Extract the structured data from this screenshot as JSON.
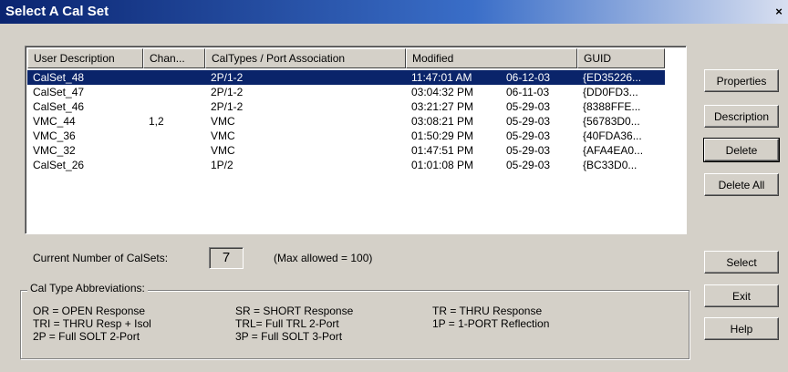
{
  "window": {
    "title": "Select A Cal Set",
    "close_glyph": "×"
  },
  "list": {
    "columns": [
      "User Description",
      "Chan...",
      "CalTypes / Port Association",
      "Modified",
      "GUID"
    ],
    "rows": [
      {
        "desc": "CalSet_48",
        "chan": "",
        "caltype": "2P/1-2",
        "time": "11:47:01 AM",
        "date": "06-12-03",
        "guid": "{ED35226...",
        "selected": true
      },
      {
        "desc": "CalSet_47",
        "chan": "",
        "caltype": "2P/1-2",
        "time": "03:04:32 PM",
        "date": "06-11-03",
        "guid": "{DD0FD3...",
        "selected": false
      },
      {
        "desc": "CalSet_46",
        "chan": "",
        "caltype": "2P/1-2",
        "time": "03:21:27 PM",
        "date": "05-29-03",
        "guid": "{8388FFE...",
        "selected": false
      },
      {
        "desc": "VMC_44",
        "chan": "1,2",
        "caltype": "VMC",
        "time": "03:08:21 PM",
        "date": "05-29-03",
        "guid": "{56783D0...",
        "selected": false
      },
      {
        "desc": "VMC_36",
        "chan": "",
        "caltype": "VMC",
        "time": "01:50:29 PM",
        "date": "05-29-03",
        "guid": "{40FDA36...",
        "selected": false
      },
      {
        "desc": "VMC_32",
        "chan": "",
        "caltype": "VMC",
        "time": "01:47:51 PM",
        "date": "05-29-03",
        "guid": "{AFA4EA0...",
        "selected": false
      },
      {
        "desc": "CalSet_26",
        "chan": "",
        "caltype": "1P/2",
        "time": "01:01:08 PM",
        "date": "05-29-03",
        "guid": "{BC33D0...",
        "selected": false
      }
    ]
  },
  "buttons": {
    "properties": "Properties",
    "description": "Description",
    "delete": "Delete",
    "delete_all": "Delete All",
    "select": "Select",
    "exit": "Exit",
    "help": "Help"
  },
  "count": {
    "label": "Current Number of CalSets:",
    "value": "7",
    "max": "(Max allowed = 100)"
  },
  "abbreviations": {
    "title": "Cal Type Abbreviations:",
    "items": [
      "OR  = OPEN Response",
      "SR  = SHORT Response",
      "TR = THRU Response",
      "TRI = THRU Resp + Isol",
      "TRL= Full TRL 2-Port",
      "1P  = 1-PORT Reflection",
      "2P  = Full SOLT 2-Port",
      "3P  = Full SOLT 3-Port"
    ]
  }
}
